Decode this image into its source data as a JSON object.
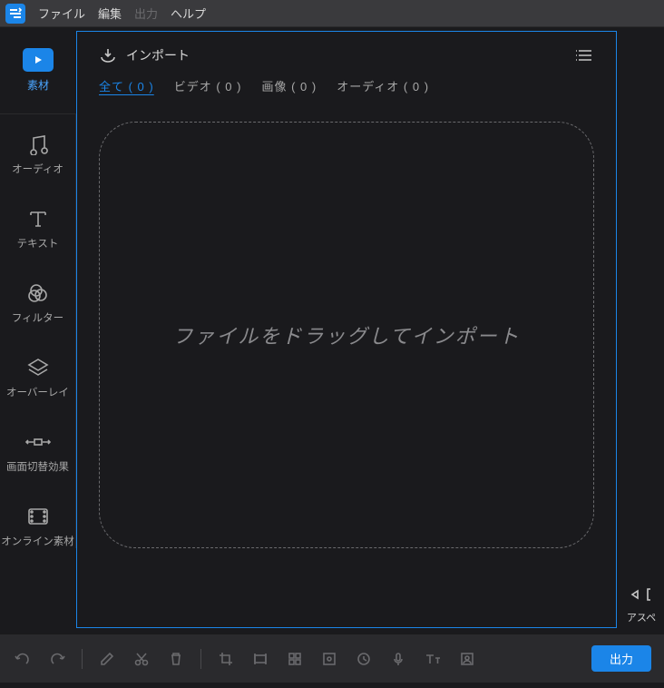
{
  "menubar": {
    "items": [
      {
        "label": "ファイル",
        "disabled": false
      },
      {
        "label": "編集",
        "disabled": false
      },
      {
        "label": "出力",
        "disabled": true
      },
      {
        "label": "ヘルプ",
        "disabled": false
      }
    ]
  },
  "sidebar": {
    "media_label": "素材",
    "items": [
      {
        "label": "オーディオ",
        "icon": "music-icon"
      },
      {
        "label": "テキスト",
        "icon": "text-icon"
      },
      {
        "label": "フィルター",
        "icon": "filter-icon"
      },
      {
        "label": "オーバーレイ",
        "icon": "overlay-icon"
      },
      {
        "label": "画面切替効果",
        "icon": "transition-icon"
      },
      {
        "label": "オンライン素材",
        "icon": "online-icon"
      }
    ]
  },
  "panel": {
    "import_label": "インポート",
    "tabs": [
      {
        "label": "全て ( 0 )",
        "active": true
      },
      {
        "label": "ビデオ ( 0 )",
        "active": false
      },
      {
        "label": "画像 ( 0 )",
        "active": false
      },
      {
        "label": "オーディオ ( 0 )",
        "active": false
      }
    ],
    "dropzone_text": "ファイルをドラッグしてインポート"
  },
  "right": {
    "label": "アスペ"
  },
  "toolbar": {
    "icons": [
      "undo-icon",
      "redo-icon",
      "sep",
      "edit-icon",
      "cut-icon",
      "delete-icon",
      "sep",
      "crop-icon",
      "trim-icon",
      "grid-icon",
      "frame-icon",
      "clock-icon",
      "mic-icon",
      "textfx-icon",
      "user-icon"
    ],
    "export_label": "出力"
  },
  "colors": {
    "accent": "#1b85e8"
  }
}
